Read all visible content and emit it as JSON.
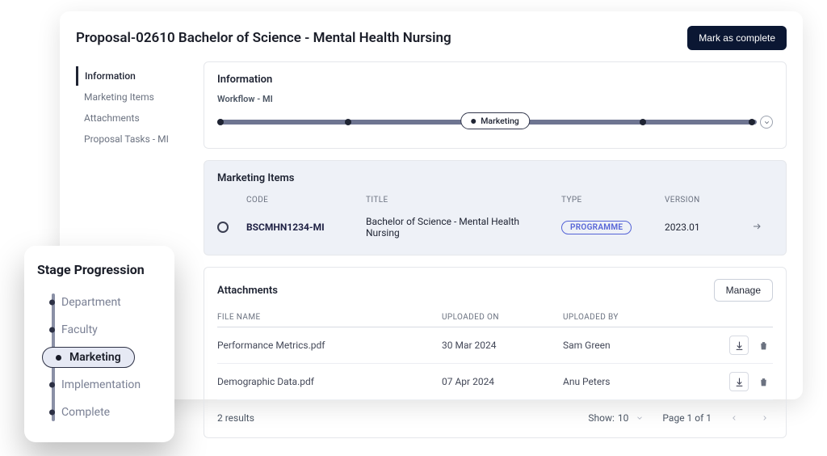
{
  "page_title": "Proposal-02610 Bachelor of Science - Mental Health Nursing",
  "mark_complete_label": "Mark as complete",
  "side_nav": {
    "items": [
      {
        "label": "Information"
      },
      {
        "label": "Marketing Items"
      },
      {
        "label": "Attachments"
      },
      {
        "label": "Proposal Tasks - MI"
      }
    ],
    "active_index": 0
  },
  "information_panel": {
    "title": "Information",
    "workflow_label": "Workflow - MI",
    "workflow_chip": "Marketing"
  },
  "marketing_items": {
    "title": "Marketing Items",
    "columns": {
      "code": "CODE",
      "title": "TITLE",
      "type": "TYPE",
      "version": "VERSION"
    },
    "row": {
      "code": "BSCMHN1234-MI",
      "title": "Bachelor of Science - Mental Health Nursing",
      "type": "PROGRAMME",
      "version": "2023.01"
    }
  },
  "attachments": {
    "title": "Attachments",
    "manage_label": "Manage",
    "columns": {
      "file": "FILE NAME",
      "uploaded_on": "UPLOADED ON",
      "uploaded_by": "UPLOADED BY"
    },
    "rows": [
      {
        "file": "Performance Metrics.pdf",
        "uploaded_on": "30 Mar 2024",
        "uploaded_by": "Sam Green"
      },
      {
        "file": "Demographic Data.pdf",
        "uploaded_on": "07 Apr 2024",
        "uploaded_by": "Anu Peters"
      }
    ],
    "results_label": "2 results",
    "show_label": "Show:",
    "show_value": "10",
    "page_label": "Page 1 of 1"
  },
  "stage_progression": {
    "title": "Stage Progression",
    "stages": [
      {
        "label": "Department"
      },
      {
        "label": "Faculty"
      },
      {
        "label": "Marketing"
      },
      {
        "label": "Implementation"
      },
      {
        "label": "Complete"
      }
    ],
    "active_index": 2
  }
}
